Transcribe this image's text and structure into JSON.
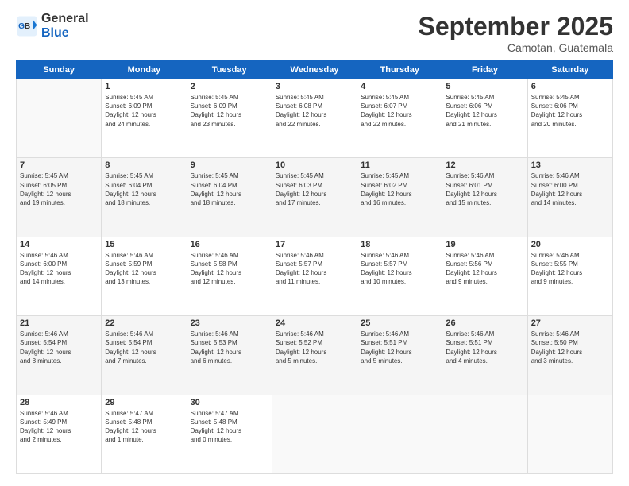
{
  "header": {
    "logo_line1": "General",
    "logo_line2": "Blue",
    "month": "September 2025",
    "location": "Camotan, Guatemala"
  },
  "days_of_week": [
    "Sunday",
    "Monday",
    "Tuesday",
    "Wednesday",
    "Thursday",
    "Friday",
    "Saturday"
  ],
  "weeks": [
    [
      {
        "day": "",
        "info": ""
      },
      {
        "day": "1",
        "info": "Sunrise: 5:45 AM\nSunset: 6:09 PM\nDaylight: 12 hours\nand 24 minutes."
      },
      {
        "day": "2",
        "info": "Sunrise: 5:45 AM\nSunset: 6:09 PM\nDaylight: 12 hours\nand 23 minutes."
      },
      {
        "day": "3",
        "info": "Sunrise: 5:45 AM\nSunset: 6:08 PM\nDaylight: 12 hours\nand 22 minutes."
      },
      {
        "day": "4",
        "info": "Sunrise: 5:45 AM\nSunset: 6:07 PM\nDaylight: 12 hours\nand 22 minutes."
      },
      {
        "day": "5",
        "info": "Sunrise: 5:45 AM\nSunset: 6:06 PM\nDaylight: 12 hours\nand 21 minutes."
      },
      {
        "day": "6",
        "info": "Sunrise: 5:45 AM\nSunset: 6:06 PM\nDaylight: 12 hours\nand 20 minutes."
      }
    ],
    [
      {
        "day": "7",
        "info": "Sunrise: 5:45 AM\nSunset: 6:05 PM\nDaylight: 12 hours\nand 19 minutes."
      },
      {
        "day": "8",
        "info": "Sunrise: 5:45 AM\nSunset: 6:04 PM\nDaylight: 12 hours\nand 18 minutes."
      },
      {
        "day": "9",
        "info": "Sunrise: 5:45 AM\nSunset: 6:04 PM\nDaylight: 12 hours\nand 18 minutes."
      },
      {
        "day": "10",
        "info": "Sunrise: 5:45 AM\nSunset: 6:03 PM\nDaylight: 12 hours\nand 17 minutes."
      },
      {
        "day": "11",
        "info": "Sunrise: 5:45 AM\nSunset: 6:02 PM\nDaylight: 12 hours\nand 16 minutes."
      },
      {
        "day": "12",
        "info": "Sunrise: 5:46 AM\nSunset: 6:01 PM\nDaylight: 12 hours\nand 15 minutes."
      },
      {
        "day": "13",
        "info": "Sunrise: 5:46 AM\nSunset: 6:00 PM\nDaylight: 12 hours\nand 14 minutes."
      }
    ],
    [
      {
        "day": "14",
        "info": "Sunrise: 5:46 AM\nSunset: 6:00 PM\nDaylight: 12 hours\nand 14 minutes."
      },
      {
        "day": "15",
        "info": "Sunrise: 5:46 AM\nSunset: 5:59 PM\nDaylight: 12 hours\nand 13 minutes."
      },
      {
        "day": "16",
        "info": "Sunrise: 5:46 AM\nSunset: 5:58 PM\nDaylight: 12 hours\nand 12 minutes."
      },
      {
        "day": "17",
        "info": "Sunrise: 5:46 AM\nSunset: 5:57 PM\nDaylight: 12 hours\nand 11 minutes."
      },
      {
        "day": "18",
        "info": "Sunrise: 5:46 AM\nSunset: 5:57 PM\nDaylight: 12 hours\nand 10 minutes."
      },
      {
        "day": "19",
        "info": "Sunrise: 5:46 AM\nSunset: 5:56 PM\nDaylight: 12 hours\nand 9 minutes."
      },
      {
        "day": "20",
        "info": "Sunrise: 5:46 AM\nSunset: 5:55 PM\nDaylight: 12 hours\nand 9 minutes."
      }
    ],
    [
      {
        "day": "21",
        "info": "Sunrise: 5:46 AM\nSunset: 5:54 PM\nDaylight: 12 hours\nand 8 minutes."
      },
      {
        "day": "22",
        "info": "Sunrise: 5:46 AM\nSunset: 5:54 PM\nDaylight: 12 hours\nand 7 minutes."
      },
      {
        "day": "23",
        "info": "Sunrise: 5:46 AM\nSunset: 5:53 PM\nDaylight: 12 hours\nand 6 minutes."
      },
      {
        "day": "24",
        "info": "Sunrise: 5:46 AM\nSunset: 5:52 PM\nDaylight: 12 hours\nand 5 minutes."
      },
      {
        "day": "25",
        "info": "Sunrise: 5:46 AM\nSunset: 5:51 PM\nDaylight: 12 hours\nand 5 minutes."
      },
      {
        "day": "26",
        "info": "Sunrise: 5:46 AM\nSunset: 5:51 PM\nDaylight: 12 hours\nand 4 minutes."
      },
      {
        "day": "27",
        "info": "Sunrise: 5:46 AM\nSunset: 5:50 PM\nDaylight: 12 hours\nand 3 minutes."
      }
    ],
    [
      {
        "day": "28",
        "info": "Sunrise: 5:46 AM\nSunset: 5:49 PM\nDaylight: 12 hours\nand 2 minutes."
      },
      {
        "day": "29",
        "info": "Sunrise: 5:47 AM\nSunset: 5:48 PM\nDaylight: 12 hours\nand 1 minute."
      },
      {
        "day": "30",
        "info": "Sunrise: 5:47 AM\nSunset: 5:48 PM\nDaylight: 12 hours\nand 0 minutes."
      },
      {
        "day": "",
        "info": ""
      },
      {
        "day": "",
        "info": ""
      },
      {
        "day": "",
        "info": ""
      },
      {
        "day": "",
        "info": ""
      }
    ]
  ]
}
